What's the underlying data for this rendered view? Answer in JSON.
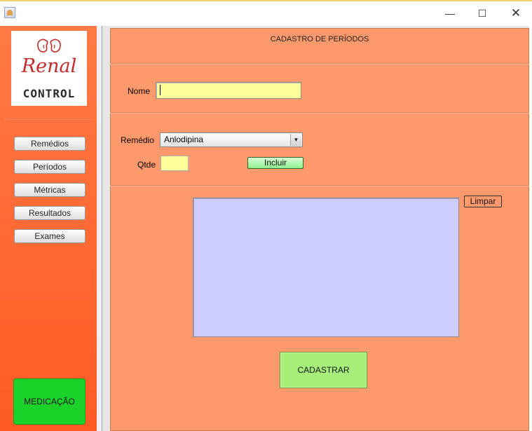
{
  "window": {
    "minimize_glyph": "—",
    "maximize_glyph": "☐",
    "close_glyph": "✕"
  },
  "logo": {
    "line1": "Renal",
    "line2": "CONTROL"
  },
  "sidebar": {
    "items": [
      {
        "label": "Remédios"
      },
      {
        "label": "Períodos"
      },
      {
        "label": "Métricas"
      },
      {
        "label": "Resultados"
      },
      {
        "label": "Exames"
      }
    ],
    "action_label": "MEDICAÇÃO"
  },
  "form": {
    "title": "CADASTRO DE PERÍODOS",
    "nome_label": "Nome",
    "nome_value": "",
    "remedio_label": "Remédio",
    "remedio_selected": "Anlodipina",
    "qtde_label": "Qtde",
    "qtde_value": "",
    "incluir_label": "Incluir",
    "limpar_label": "Limpar",
    "list_items": [],
    "cadastrar_label": "CADASTRAR"
  },
  "colors": {
    "sidebar_top": "#ff7a45",
    "panel": "#fd996a",
    "input_bg": "#ffff99",
    "list_bg": "#ccccff",
    "medicacao_btn": "#1bd22b",
    "cadastrar_btn": "#a6f07a"
  },
  "icons": {
    "app": "java-icon",
    "logo": "kidneys-icon",
    "select": "dropdown-arrow-icon"
  }
}
